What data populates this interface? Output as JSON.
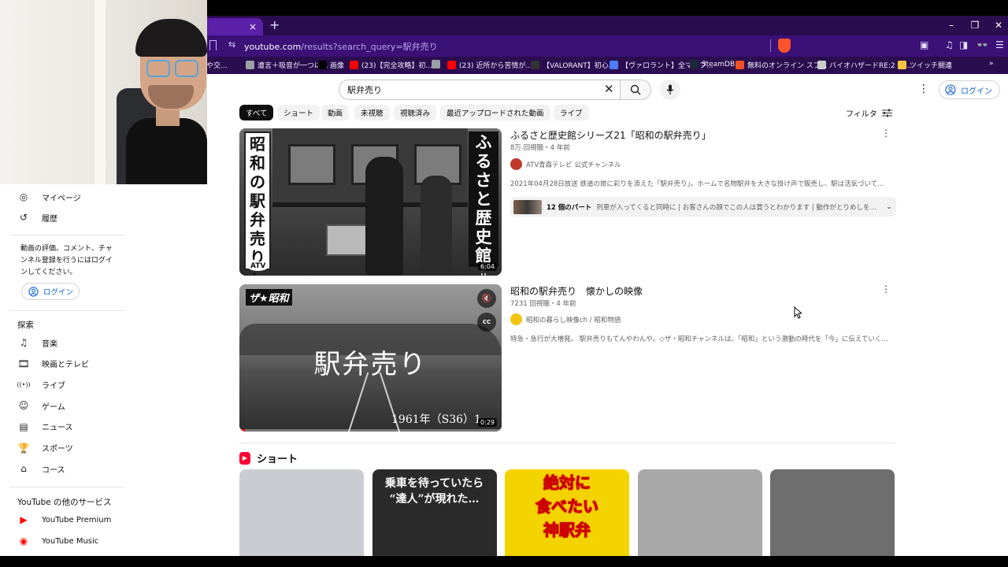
{
  "browser": {
    "tab_close": "×",
    "new_tab": "+",
    "window_controls": [
      "–",
      "❐",
      "✕"
    ],
    "url_domain": "youtube.com",
    "url_rest": "/results?search_query=駅弁売り",
    "bookmarks": [
      {
        "label": "や交...",
        "color": "#9aa0a6"
      },
      {
        "label": "遭言＋吸音が一つに...",
        "color": "#9aa0a6"
      },
      {
        "label": "画像",
        "color": "#000000"
      },
      {
        "label": "(23)【完全攻略】初...",
        "color": "#ff0000"
      },
      {
        "label": "",
        "color": "#9aa0a6"
      },
      {
        "label": "(23) 近所から苦情が...",
        "color": "#ff0000"
      },
      {
        "label": "【VALORANT】初心...",
        "color": "#333333"
      },
      {
        "label": "【ヴァロラント】全マップ...",
        "color": "#4d7cff"
      },
      {
        "label": "SteamDB",
        "color": "#1b2838"
      },
      {
        "label": "無料のオンライン スプ...",
        "color": "#f25022"
      },
      {
        "label": "バイオハザードRE:2 全...",
        "color": "#cccccc"
      },
      {
        "label": "ツイッチ關連",
        "color": "#f5c542"
      }
    ]
  },
  "header": {
    "search_value": "駅弁売り",
    "login_label": "ログイン"
  },
  "chips": [
    {
      "label": "すべて",
      "active": true
    },
    {
      "label": "ショート"
    },
    {
      "label": "動画"
    },
    {
      "label": "未視聴"
    },
    {
      "label": "視聴済み"
    },
    {
      "label": "最近アップロードされた動画"
    },
    {
      "label": "ライブ"
    }
  ],
  "filter_label": "フィルタ",
  "sidebar": {
    "items_top": [
      {
        "label": "マイページ",
        "icon": "account-icon"
      },
      {
        "label": "履歴",
        "icon": "history-icon"
      }
    ],
    "note": "動画の評価、コメント、チャンネル登録を行うにはログインしてください。",
    "login_label": "ログイン",
    "explore_header": "探索",
    "explore_items": [
      {
        "label": "音楽",
        "icon": "music-icon"
      },
      {
        "label": "映画とテレビ",
        "icon": "movie-icon"
      },
      {
        "label": "ライブ",
        "icon": "live-icon"
      },
      {
        "label": "ゲーム",
        "icon": "gaming-icon"
      },
      {
        "label": "ニュース",
        "icon": "news-icon"
      },
      {
        "label": "スポーツ",
        "icon": "trophy-icon"
      },
      {
        "label": "コース",
        "icon": "course-icon"
      }
    ],
    "more_header": "YouTube の他のサービス",
    "more_items": [
      {
        "label": "YouTube Premium",
        "icon": "youtube-premium-icon"
      },
      {
        "label": "YouTube Music",
        "icon": "youtube-music-icon"
      }
    ]
  },
  "results": [
    {
      "title": "ふるさと歴史館シリーズ21「昭和の駅弁売り」",
      "meta": "8万 回視聴・4 年前",
      "channel": "ATV青森テレビ 公式チャンネル",
      "channel_color": "#c0392b",
      "description": "2021年04月28日放送 鉄道の旅に彩りを添えた「駅弁売り」。ホームで名物駅弁を大きな掛け声で販売し、駅は活気づいていまし ...",
      "duration": "6:04",
      "thumb_left_text": "「昭和の駅弁売り」",
      "thumb_right_text": "ふるさと歴史館",
      "thumb_right_small": "シリーズ",
      "thumb_logo": "ATV",
      "chapters_count": "12 個のパート",
      "chapters_text": "列車が入ってくると同時に | お客さんの顔でこの人は買うとわかります | 動作がとりめしを買うよ..."
    },
    {
      "title": "昭和の駅弁売り　懐かしの映像",
      "meta": "7231 回視聴・4 年前",
      "channel": "昭和の暮らし映像ch / 昭和物語",
      "channel_color": "#f1c40f",
      "description": "特急・急行が大増発。 駅弁売りもてんやわんや。◇ザ・昭和チャンネルは、「昭和」という激動の時代を「今」に伝えていく ...",
      "duration": "0:29",
      "thumb_logo": "ザ★昭和",
      "thumb_big_text": "駅弁売り",
      "thumb_year_text": "1961年（S36）1",
      "thumb_cc": "CC",
      "progress": 0.02
    }
  ],
  "shorts": {
    "header": "ショート",
    "items": [
      {
        "caption": "",
        "bg": "#c9cdd2"
      },
      {
        "caption": "乗車を待っていたら\n“達人”が現れた…",
        "bg": "#2a2a2a"
      },
      {
        "caption": "絶対に\n食べたい\n神駅弁",
        "bg": "#f4d400"
      },
      {
        "caption": "",
        "bg": "#a9a9a9"
      },
      {
        "caption": "",
        "bg": "#6e6e6e"
      }
    ]
  }
}
